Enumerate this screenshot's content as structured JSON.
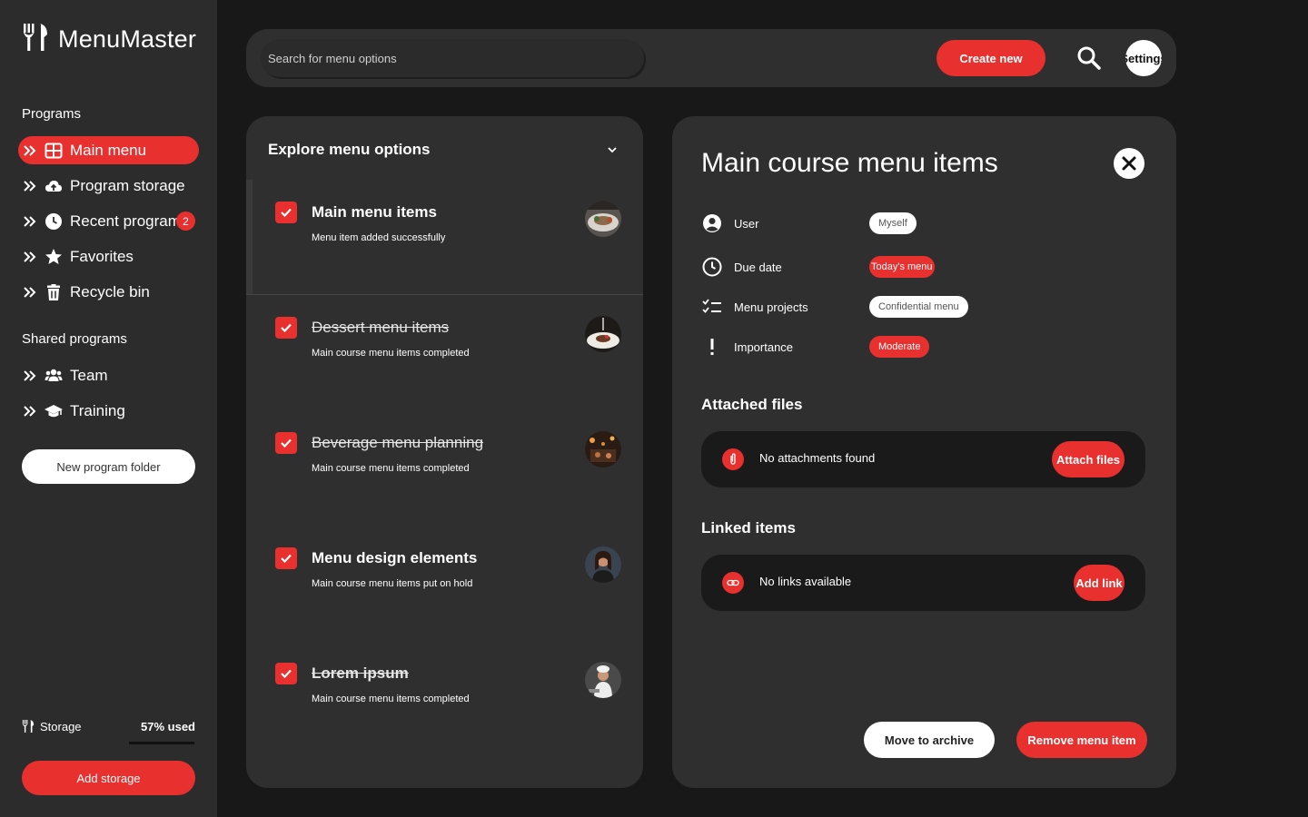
{
  "app": {
    "name": "MenuMaster"
  },
  "colors": {
    "accent": "#e8302f",
    "sidebar": "#2c2c2c",
    "panel": "#2f2f2f",
    "background": "#181818"
  },
  "sidebar": {
    "programs_title": "Programs",
    "items": [
      {
        "label": "Main menu",
        "icon": "grid-icon",
        "active": true
      },
      {
        "label": "Program storage",
        "icon": "cloud-upload-icon"
      },
      {
        "label": "Recent programs",
        "icon": "clock-icon",
        "badge": "2"
      },
      {
        "label": "Favorites",
        "icon": "star-icon"
      },
      {
        "label": "Recycle bin",
        "icon": "trash-icon"
      }
    ],
    "shared_title": "Shared programs",
    "shared_items": [
      {
        "label": "Team",
        "icon": "users-icon"
      },
      {
        "label": "Training",
        "icon": "graduation-cap-icon"
      }
    ],
    "new_folder_label": "New program folder",
    "storage_label": "Storage",
    "storage_used": "57% used",
    "storage_fraction": 0.57,
    "add_storage_label": "Add storage"
  },
  "topbar": {
    "search_placeholder": "Search for menu options",
    "create_label": "Create new",
    "settings_label": "Settings"
  },
  "explore": {
    "title": "Explore menu options",
    "items": [
      {
        "title": "Main menu items",
        "subtitle": "Menu item added successfully",
        "completed": false
      },
      {
        "title": "Dessert menu items",
        "subtitle": "Main course menu items completed",
        "completed": true
      },
      {
        "title": "Beverage menu planning",
        "subtitle": "Main course menu items completed",
        "completed": true
      },
      {
        "title": "Menu design elements",
        "subtitle": "Main course menu items put on hold",
        "completed": false
      },
      {
        "title": "Lorem ipsum",
        "subtitle": "Main course menu items completed",
        "completed": true
      }
    ]
  },
  "detail": {
    "title": "Main course menu items",
    "properties": [
      {
        "label": "User",
        "value": "Myself",
        "style": "white"
      },
      {
        "label": "Due date",
        "value": "Today's menu",
        "style": "red"
      },
      {
        "label": "Menu projects",
        "value": "Confidential menu",
        "style": "white"
      },
      {
        "label": "Importance",
        "value": "Moderate",
        "style": "red"
      }
    ],
    "attached_title": "Attached files",
    "attached_empty": "No attachments found",
    "attach_label": "Attach files",
    "linked_title": "Linked items",
    "linked_empty": "No links available",
    "add_link_label": "Add link",
    "archive_label": "Move to archive",
    "remove_label": "Remove menu item"
  }
}
